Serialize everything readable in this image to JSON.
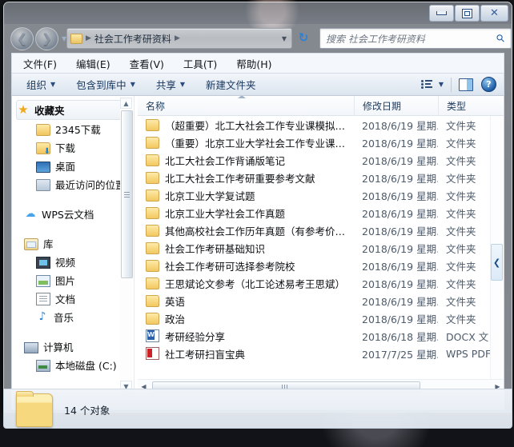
{
  "window": {
    "controls": {
      "minimize": "最小化",
      "maximize": "最大化",
      "close": "关闭"
    }
  },
  "address": {
    "back": "后退",
    "forward": "前进",
    "history_dropdown": "最近浏览的位置",
    "crumb_root": "",
    "crumb_current": "社会工作考研资料",
    "dropdown": "▼",
    "refresh": "刷新"
  },
  "search": {
    "placeholder": "搜索 社会工作考研资料",
    "value": "",
    "icon": "search-icon"
  },
  "menubar": {
    "items": [
      {
        "label": "文件(F)"
      },
      {
        "label": "编辑(E)"
      },
      {
        "label": "查看(V)"
      },
      {
        "label": "工具(T)"
      },
      {
        "label": "帮助(H)"
      }
    ]
  },
  "commandbar": {
    "items": [
      {
        "label": "组织",
        "has_caret": true
      },
      {
        "label": "包含到库中",
        "has_caret": true
      },
      {
        "label": "共享",
        "has_caret": true
      },
      {
        "label": "新建文件夹",
        "has_caret": false
      }
    ],
    "view_button": "更改您的视图",
    "view_caret": "▼",
    "preview_pane_button": "显示预览窗格",
    "help_button": "?"
  },
  "navpane": {
    "groups": [
      {
        "header": {
          "label": "收藏夹",
          "icon": "star-icon",
          "selected": true
        },
        "items": [
          {
            "label": "2345下载",
            "icon": "folder-icon"
          },
          {
            "label": "下载",
            "icon": "downloads-folder-icon"
          },
          {
            "label": "桌面",
            "icon": "desktop-icon"
          },
          {
            "label": "最近访问的位置",
            "icon": "recent-places-icon"
          }
        ]
      },
      {
        "header": {
          "label": "WPS云文档",
          "icon": "cloud-icon",
          "selected": false
        },
        "items": []
      },
      {
        "header": {
          "label": "库",
          "icon": "library-icon",
          "selected": false
        },
        "items": [
          {
            "label": "视频",
            "icon": "video-icon"
          },
          {
            "label": "图片",
            "icon": "picture-icon"
          },
          {
            "label": "文档",
            "icon": "document-icon"
          },
          {
            "label": "音乐",
            "icon": "music-icon"
          }
        ]
      },
      {
        "header": {
          "label": "计算机",
          "icon": "computer-icon",
          "selected": false
        },
        "items": [
          {
            "label": "本地磁盘 (C:)",
            "icon": "disk-icon"
          }
        ]
      }
    ]
  },
  "filelist": {
    "columns": [
      {
        "label": "名称",
        "key": "name",
        "sorted": true
      },
      {
        "label": "修改日期",
        "key": "date"
      },
      {
        "label": "类型",
        "key": "type"
      }
    ],
    "rows": [
      {
        "name": "（超重要）北工大社会工作专业课模拟题...",
        "date": "2018/6/19 星期...",
        "type": "文件夹",
        "icon": "folder-icon"
      },
      {
        "name": "（重要）北京工业大学社会工作专业课答...",
        "date": "2018/6/19 星期...",
        "type": "文件夹",
        "icon": "folder-icon"
      },
      {
        "name": "北工大社会工作背诵版笔记",
        "date": "2018/6/19 星期...",
        "type": "文件夹",
        "icon": "folder-icon"
      },
      {
        "name": "北工大社会工作考研重要参考文献",
        "date": "2018/6/19 星期...",
        "type": "文件夹",
        "icon": "folder-icon"
      },
      {
        "name": "北京工业大学复试题",
        "date": "2018/6/19 星期...",
        "type": "文件夹",
        "icon": "folder-icon"
      },
      {
        "name": "北京工业大学社会工作真题",
        "date": "2018/6/19 星期...",
        "type": "文件夹",
        "icon": "folder-icon"
      },
      {
        "name": "其他高校社会工作历年真题（有参考价值...",
        "date": "2018/6/19 星期...",
        "type": "文件夹",
        "icon": "folder-icon"
      },
      {
        "name": "社会工作考研基础知识",
        "date": "2018/6/19 星期...",
        "type": "文件夹",
        "icon": "folder-icon"
      },
      {
        "name": "社会工作考研可选择参考院校",
        "date": "2018/6/19 星期...",
        "type": "文件夹",
        "icon": "folder-icon"
      },
      {
        "name": "王思斌论文参考（北工论述易考王思斌）",
        "date": "2018/6/19 星期...",
        "type": "文件夹",
        "icon": "folder-icon"
      },
      {
        "name": "英语",
        "date": "2018/6/19 星期...",
        "type": "文件夹",
        "icon": "folder-icon"
      },
      {
        "name": "政治",
        "date": "2018/6/19 星期...",
        "type": "文件夹",
        "icon": "folder-icon"
      },
      {
        "name": "考研经验分享",
        "date": "2018/6/18 星期...",
        "type": "DOCX 文",
        "icon": "docx-icon"
      },
      {
        "name": "社工考研扫盲宝典",
        "date": "2017/7/25 星期...",
        "type": "WPS PDF",
        "icon": "pdf-icon"
      }
    ],
    "preview_toggle": "❮",
    "hscroll_left": "◀",
    "hscroll_right": "▶"
  },
  "statusbar": {
    "count_text": "14 个对象",
    "folder_icon": "large-folder-icon"
  }
}
